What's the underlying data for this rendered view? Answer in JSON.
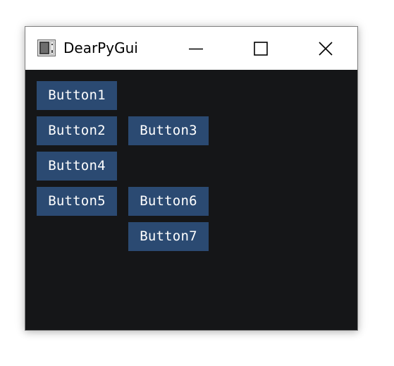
{
  "window": {
    "title": "DearPyGui",
    "icon": "app-icon",
    "controls": {
      "minimize_icon": "minimize-icon",
      "maximize_icon": "maximize-icon",
      "close_icon": "close-icon"
    }
  },
  "buttons": [
    {
      "label": "Button1"
    },
    {
      "label": "Button2"
    },
    {
      "label": "Button3"
    },
    {
      "label": "Button4"
    },
    {
      "label": "Button5"
    },
    {
      "label": "Button6"
    },
    {
      "label": "Button7"
    }
  ],
  "colors": {
    "client_background": "#151618",
    "button_background": "#2b4a72",
    "button_text": "#ffffff",
    "titlebar_background": "#ffffff"
  }
}
